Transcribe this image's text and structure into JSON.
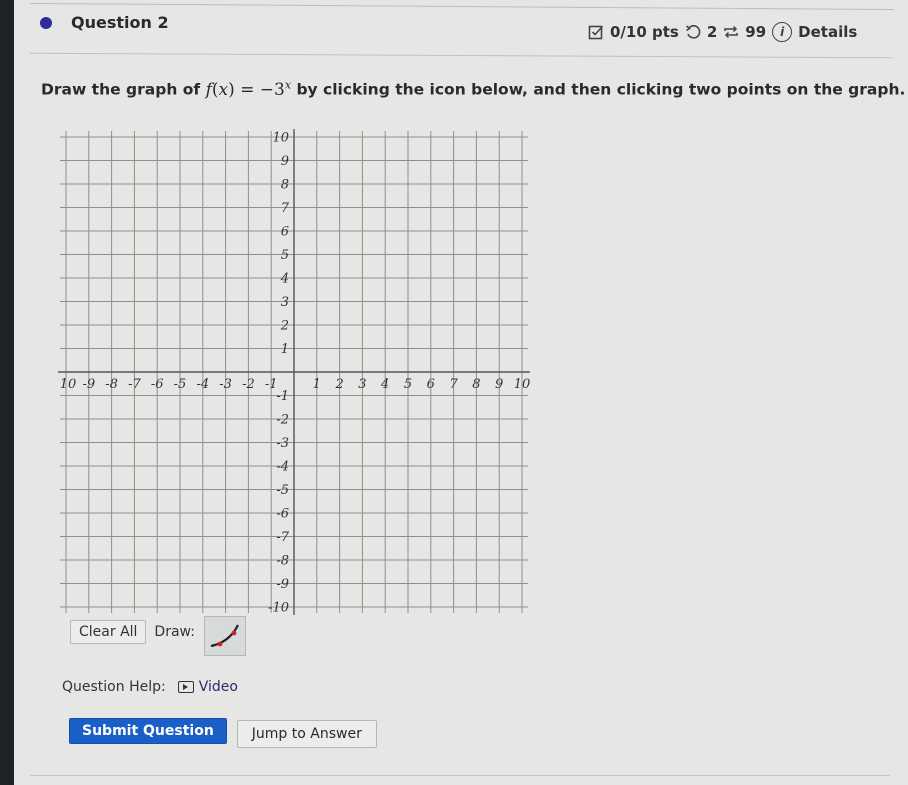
{
  "question": {
    "title": "Question 2",
    "score": "0/10 pts",
    "retries": "2",
    "attempts": "99",
    "details_label": "Details",
    "icons": {
      "score": "checkbox-icon",
      "retry": "undo-icon",
      "attempts": "repeat-icon",
      "details": "info-icon"
    }
  },
  "prompt": {
    "before": "Draw the graph of ",
    "func_name": "f",
    "func_var": "x",
    "func_rhs_base": "−3",
    "func_rhs_exp": "x",
    "after": " by clicking the icon below, and then clicking two points on the graph."
  },
  "chart_data": {
    "type": "scatter",
    "title": "",
    "xlabel": "",
    "ylabel": "",
    "xlim": [
      -10,
      10
    ],
    "ylim": [
      -10,
      10
    ],
    "grid": true,
    "x_ticks": [
      -10,
      -9,
      -8,
      -7,
      -6,
      -5,
      -4,
      -3,
      -2,
      -1,
      1,
      2,
      3,
      4,
      5,
      6,
      7,
      8,
      9,
      10
    ],
    "y_ticks": [
      -10,
      -9,
      -8,
      -7,
      -6,
      -5,
      -4,
      -3,
      -2,
      -1,
      1,
      2,
      3,
      4,
      5,
      6,
      7,
      8,
      9,
      10
    ],
    "x_tick_labels": [
      "10",
      "-9",
      "-8",
      "-7",
      "-6",
      "-5",
      "-4",
      "-3",
      "-2",
      "-1",
      "1",
      "2",
      "3",
      "4",
      "5",
      "6",
      "7",
      "8",
      "9",
      "10"
    ],
    "y_tick_labels": [
      "-10",
      "-9",
      "-8",
      "-7",
      "-6",
      "-5",
      "-4",
      "-3",
      "-2",
      "-1",
      "1",
      "2",
      "3",
      "4",
      "5",
      "6",
      "7",
      "8",
      "9",
      "10"
    ],
    "series": []
  },
  "tools": {
    "clear_label": "Clear All",
    "draw_label": "Draw:",
    "draw_tool_icon": "exponential-curve-icon",
    "colors": {
      "curve": "#222222",
      "points": "#d0202a"
    }
  },
  "help": {
    "label": "Question Help:",
    "video_label": "Video"
  },
  "actions": {
    "submit_label": "Submit Question",
    "jump_label": "Jump to Answer"
  }
}
